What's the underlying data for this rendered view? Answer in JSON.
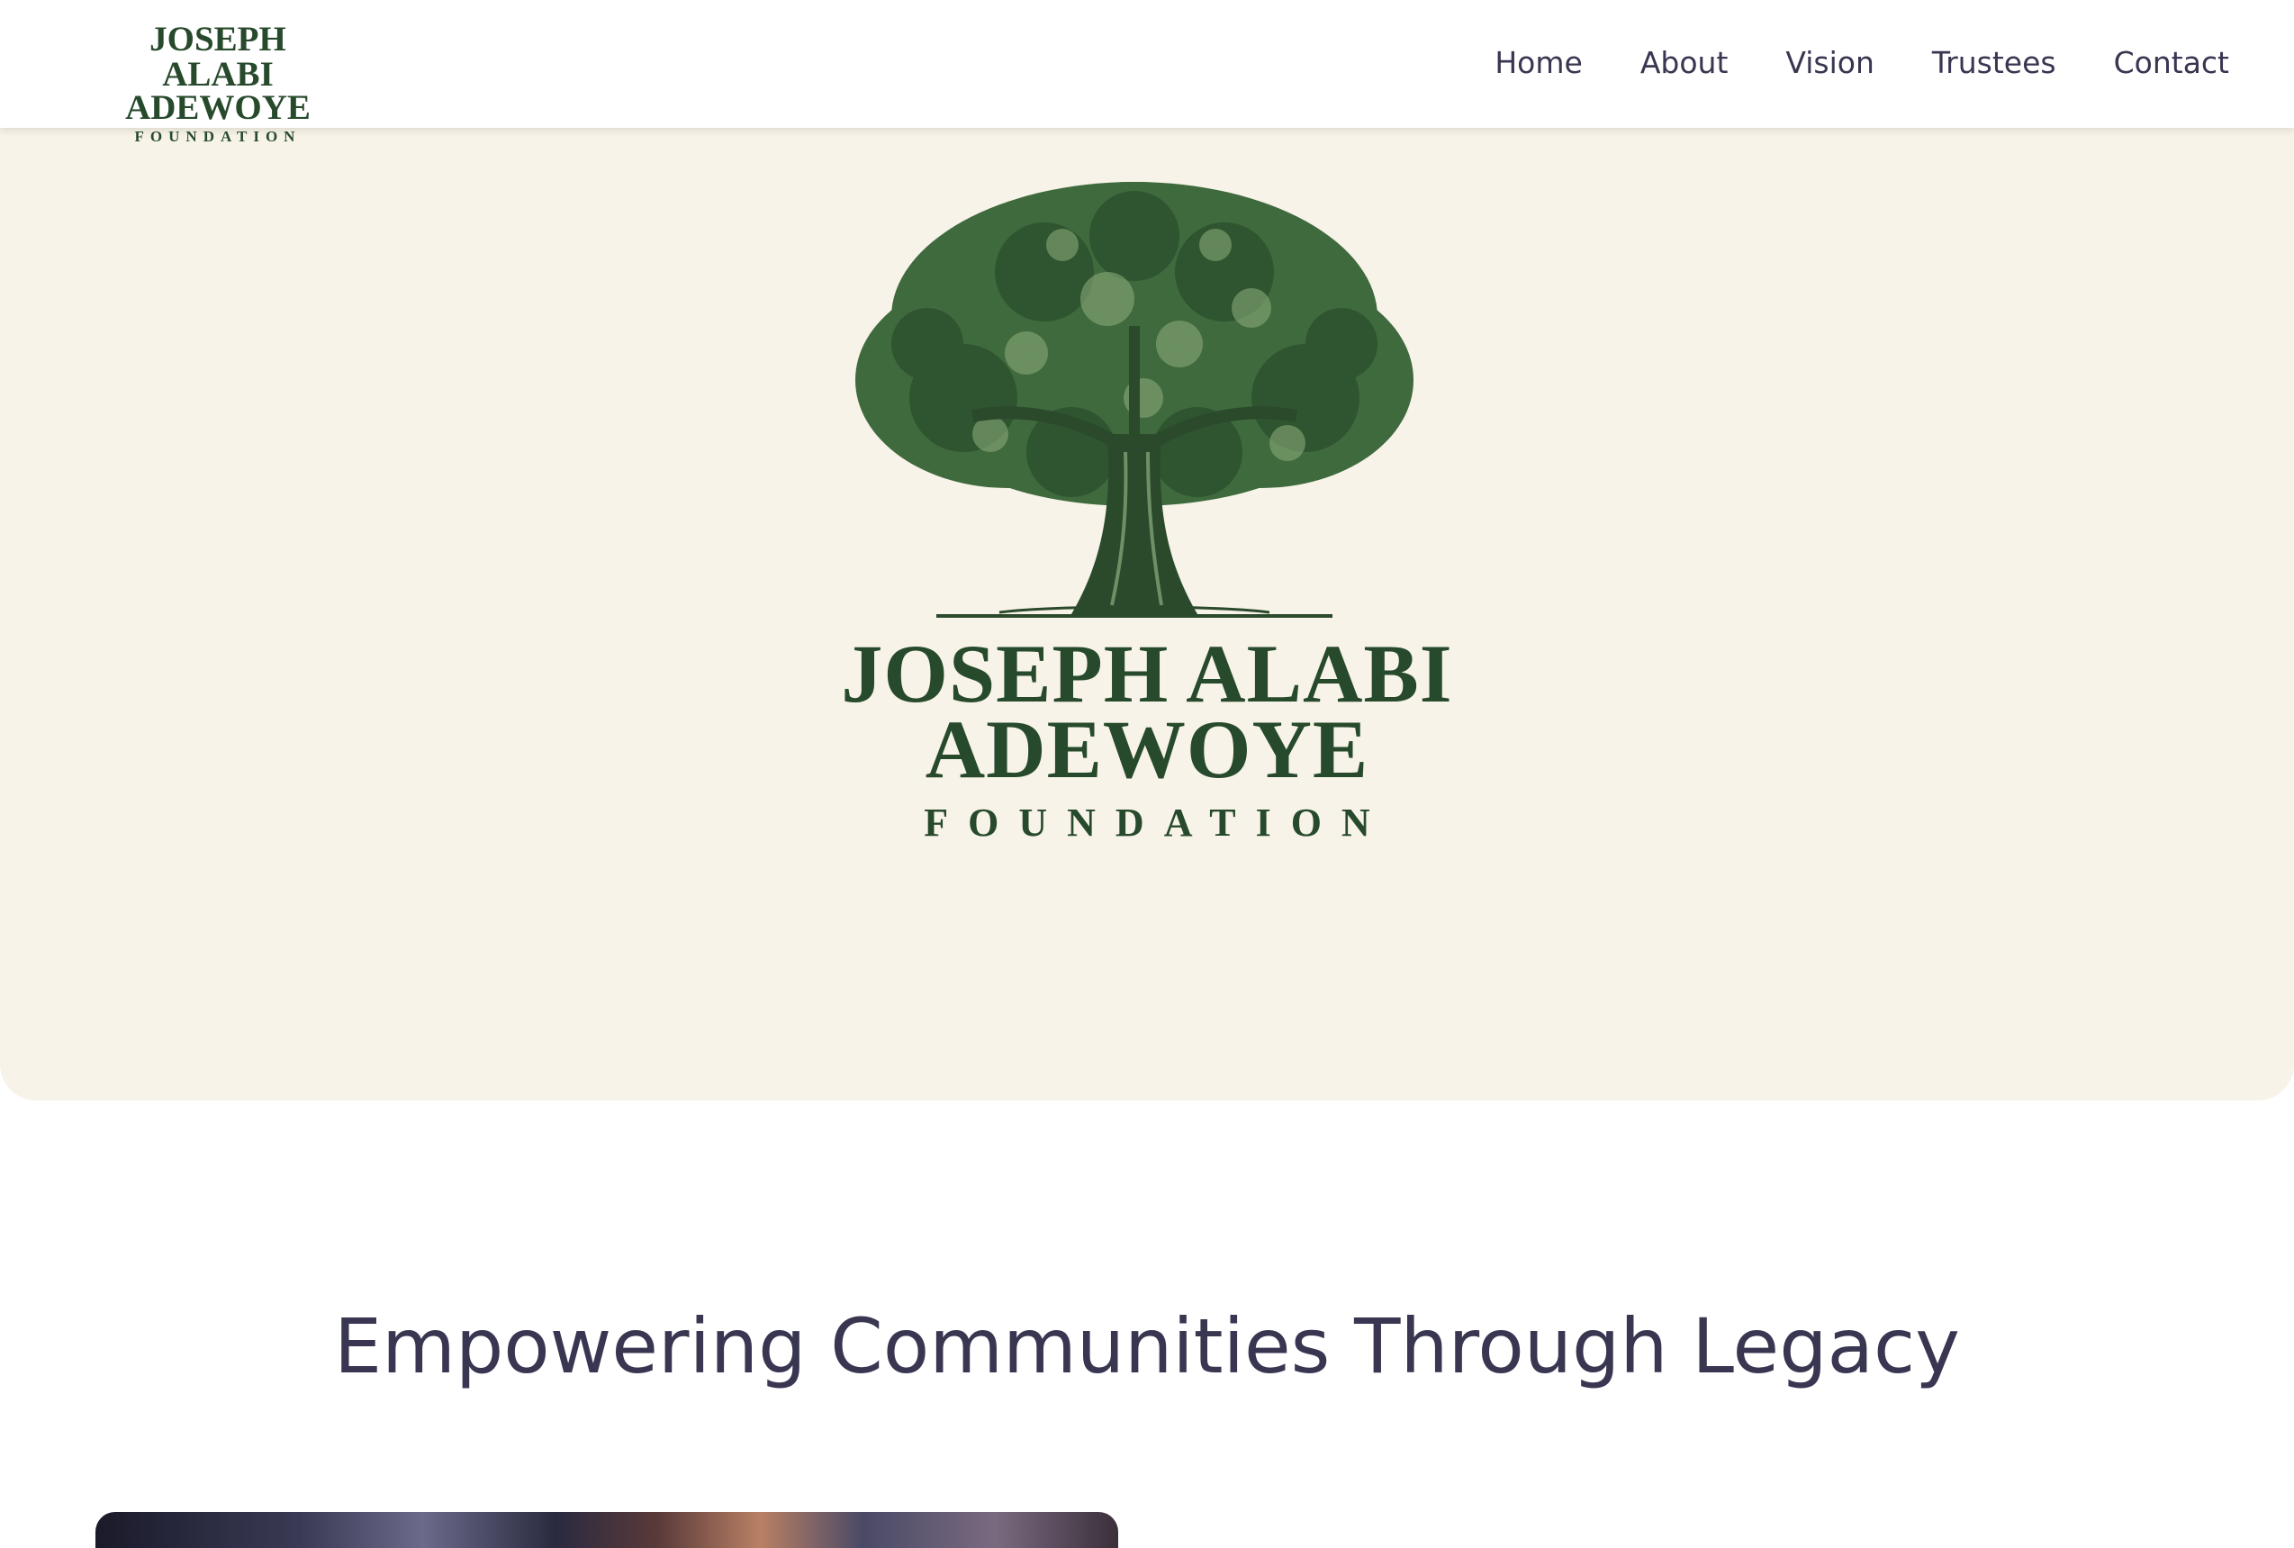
{
  "header": {
    "logo": {
      "line1": "JOSEPH ALABI",
      "line2": "ADEWOYE",
      "line3": "FOUNDATION"
    },
    "nav": [
      {
        "label": "Home"
      },
      {
        "label": "About"
      },
      {
        "label": "Vision"
      },
      {
        "label": "Trustees"
      },
      {
        "label": "Contact"
      }
    ]
  },
  "hero": {
    "logo": {
      "line1": "JOSEPH ALABI",
      "line2": "ADEWOYE",
      "line3": "FOUNDATION"
    },
    "icon": "oak-tree-icon"
  },
  "section": {
    "title": "Empowering Communities Through Legacy"
  },
  "colors": {
    "brand_green": "#284a2c",
    "hero_background": "#f7f3e8",
    "text_dark": "#383651"
  }
}
